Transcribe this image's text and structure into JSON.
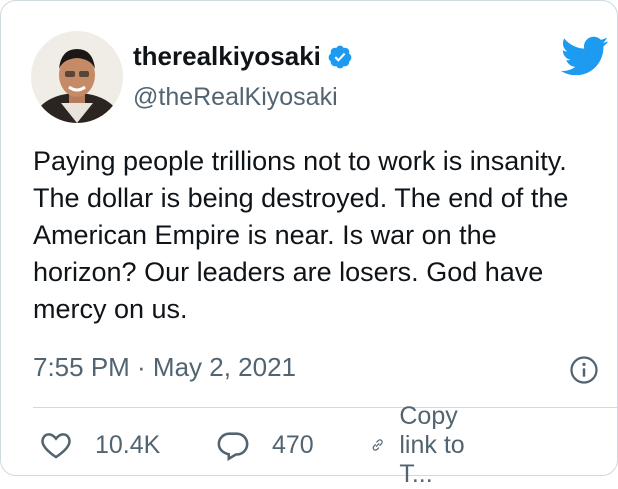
{
  "author": {
    "display_name": "therealkiyosaki",
    "handle": "@theRealKiyosaki",
    "verified_icon": "verified-badge-icon",
    "avatar_icon": "avatar"
  },
  "brand": {
    "icon": "twitter-bird-icon",
    "color": "#1d9bf0"
  },
  "tweet": {
    "lines": [
      "Paying people trillions not to work is insanity.",
      "The dollar is being destroyed. The end of the",
      "American Empire is near. Is war on the",
      "horizon? Our leaders are losers. God have",
      "mercy on us."
    ],
    "timestamp": "7:55 PM · May 2, 2021",
    "info_icon": "info-icon"
  },
  "actions": {
    "likes": "10.4K",
    "replies": "470",
    "copy_link": "Copy link to T..."
  },
  "colors": {
    "text": "#0f1419",
    "secondary": "#536471",
    "border": "#cfd9de"
  }
}
